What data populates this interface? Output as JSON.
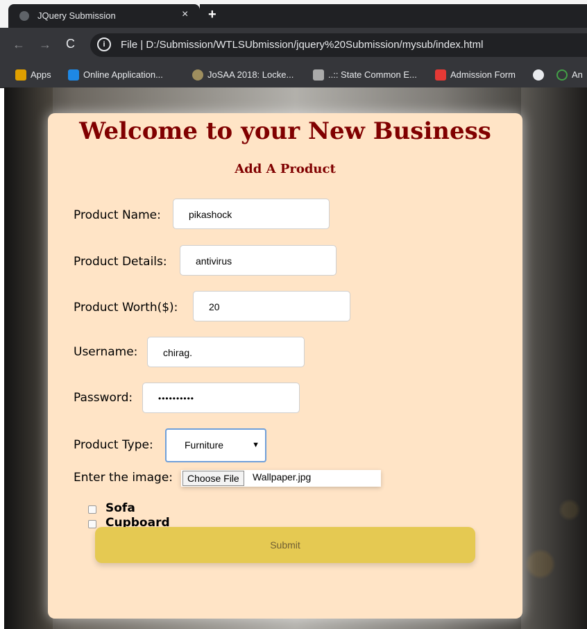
{
  "browser": {
    "tab_title": "JQuery Submission",
    "tab_close": "×",
    "new_tab": "+",
    "nav_back": "←",
    "nav_forward": "→",
    "reload": "C",
    "info": "i",
    "url": "File  |  D:/Submission/WTLSUbmission/jquery%20Submission/mysub/index.html",
    "bookmarks": [
      {
        "label": "Apps",
        "icon": "apps-grid-icon",
        "color": "#e0a000"
      },
      {
        "label": "Online Application...",
        "icon": "sap-icon",
        "color": "#1e88e5"
      },
      {
        "label": "JoSAA 2018: Locke...",
        "icon": "josaa-icon",
        "color": "#9e8e5e"
      },
      {
        "label": "..:: State Common E...",
        "icon": "state-cet-icon",
        "color": "#aaaaaa"
      },
      {
        "label": "Admission Form",
        "icon": "admission-icon",
        "color": "#e53935"
      },
      {
        "label": "",
        "icon": "globe-icon",
        "color": "#e8eaed"
      },
      {
        "label": "An",
        "icon": "loading-ring-icon",
        "color": "#43a047"
      }
    ]
  },
  "page": {
    "heading": "Welcome to your New Business",
    "subheading": "Add A Product",
    "fields": {
      "product_name": {
        "label": "Product Name:",
        "value": "pikashock"
      },
      "product_details": {
        "label": "Product Details:",
        "value": "antivirus"
      },
      "product_worth": {
        "label": "Product Worth($):",
        "value": "20"
      },
      "username": {
        "label": "Username:",
        "value": "chirag."
      },
      "password": {
        "label": "Password:",
        "value": "••••••••••"
      }
    },
    "product_type": {
      "label": "Product Type:",
      "selected": "Furniture",
      "arrow": "▼"
    },
    "image": {
      "label": "Enter the image:",
      "button": "Choose File",
      "filename": "Wallpaper.jpg"
    },
    "checkboxes": [
      {
        "label": "Sofa",
        "checked": false
      },
      {
        "label": "Cupboard",
        "checked": false
      }
    ],
    "submit_label": "Submit"
  },
  "colors": {
    "heading": "#800000",
    "card": "#ffe4c6",
    "submit": "#e5c952"
  }
}
